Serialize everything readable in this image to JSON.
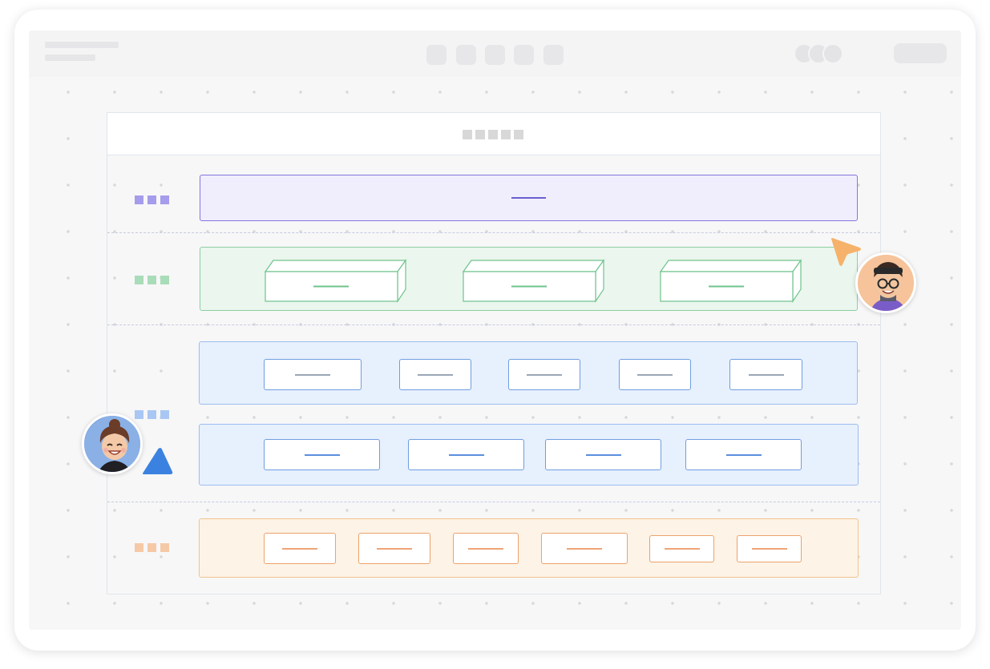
{
  "colors": {
    "purple": "#8275dd",
    "green": "#8ccfa1",
    "blue": "#6f9ee0",
    "orange": "#eba26c",
    "cursor_orange": "#f6b26b",
    "cursor_blue": "#3b82e0"
  },
  "canvas": {
    "rows": [
      {
        "name": "purple-layer",
        "color": "purple",
        "items": 1
      },
      {
        "name": "green-layer",
        "color": "green",
        "items": 3,
        "style": "3d-blocks"
      },
      {
        "name": "blue-layer",
        "color": "blue",
        "items": 9,
        "sub_rows": 2
      },
      {
        "name": "orange-layer",
        "color": "orange",
        "items": 6
      }
    ]
  },
  "collaborators": [
    {
      "name": "collaborator-glasses",
      "cursor": "cursor_orange"
    },
    {
      "name": "collaborator-smiling",
      "cursor": "cursor_blue"
    }
  ],
  "icons": [
    "collaborator-avatar-icon",
    "cursor-pointer-icon"
  ]
}
